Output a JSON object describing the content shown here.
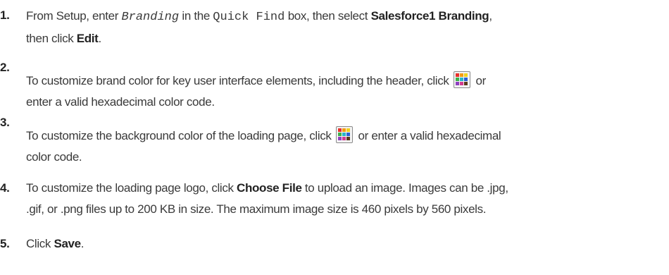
{
  "steps": [
    {
      "number": "1.",
      "t1": "From Setup, enter ",
      "code1": "Branding",
      "t2": " in the ",
      "code2": "Quick Find",
      "t3": " box, then select ",
      "b1": "Salesforce1 Branding",
      "t4": ",",
      "t5": "then click ",
      "b2": "Edit",
      "t6": "."
    },
    {
      "number": "2.",
      "t1": "To customize brand color for key user interface elements, including the header, click",
      "t2": "or",
      "t3": "enter a valid hexadecimal color code.",
      "icon": "color-picker-icon"
    },
    {
      "number": "3.",
      "t1": "To customize the background color of the loading page, click",
      "t2": "or enter a valid hexadecimal",
      "t3": "color code.",
      "icon": "color-picker-icon"
    },
    {
      "number": "4.",
      "t1": "To customize the loading page logo, click ",
      "b1": "Choose File",
      "t2": " to upload an image. Images can be .jpg,",
      "t3": ".gif, or .png files up to 200 KB in size. The maximum image size is 460 pixels by 560 pixels."
    },
    {
      "number": "5.",
      "t1": "Click ",
      "b1": "Save",
      "t2": "."
    }
  ],
  "colors": {
    "text": "#3a3a3a",
    "swatches": [
      "#e8302b",
      "#f39c12",
      "#f1d21c",
      "#3cb24a",
      "#27b6c9",
      "#2d5fd3",
      "#8e3fbf",
      "#d23c8f",
      "#5a3a1c"
    ]
  }
}
